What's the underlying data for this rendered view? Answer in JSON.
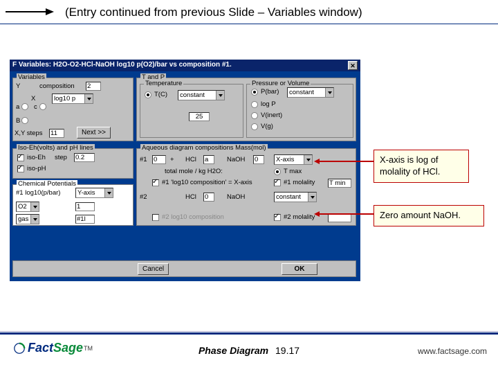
{
  "slide": {
    "title": "(Entry continued from previous Slide – Variables window)"
  },
  "window": {
    "title": "F Variables: H2O-O2-HCl-NaOH  log10 p(O2)/bar vs composition #1."
  },
  "variables": {
    "legend": "Variables",
    "y_label": "Y",
    "composition_label": "composition",
    "composition_value": "2",
    "x_label": "X",
    "log10p_label": "log10 p",
    "a_label": "a",
    "c_label": "c",
    "b_label": "B",
    "xy_steps_label": "X,Y steps",
    "xy_steps_value": "11",
    "next_label": "Next >>"
  },
  "tandp": {
    "legend": "T and P",
    "temperature_legend": "Temperature",
    "tc_label": "T(C)",
    "constant_label": "constant",
    "t_value": "25",
    "pressure_legend": "Pressure or Volume",
    "pbar_label": "P(bar)",
    "pbar_value": "constant",
    "logp_label": "log P",
    "vinert_label": "V(inert)",
    "vgas_label": "V(g)"
  },
  "iso": {
    "legend": "Iso-Eh(volts) and pH lines",
    "eh_label": "iso-Eh",
    "ph_label": "iso-pH",
    "step_label": "step",
    "step_value": "0.2"
  },
  "aqueous": {
    "legend": "Aqueous diagram compositions Mass(mol)",
    "row1_num": "#1",
    "row1_val1": "0",
    "row1_plus": "+",
    "row1_hcl": "HCl",
    "row1_a": "a",
    "row1_naoh": "NaOH",
    "row1_b": "0",
    "row1_xaxis": "X-axis",
    "total_label": "total mole / kg H2O:",
    "row2_num": "#2",
    "row2_hcl": "HCl",
    "row2_a": "0",
    "row2_naoh": "NaOH",
    "row2_constant": "constant",
    "chk1a": "#1 'log10 composition' = X-axis",
    "chk1b": "#1 molality",
    "chk2a": "#2 log10 composition",
    "chk2b": "#2 molality",
    "tmax": "T max",
    "tmin": "T min"
  },
  "chempot": {
    "legend": "Chemical Potentials",
    "h1_label": "#1 log10(p/bar)",
    "yaxis": "Y-axis",
    "o2_label": "O2",
    "o2_val": "1",
    "gas_label": "gas",
    "h1l": "#1l"
  },
  "buttons": {
    "cancel": "Cancel",
    "ok": "OK"
  },
  "callouts": {
    "c1a": "X-axis is log of",
    "c1b": "molality of HCl.",
    "c2": "Zero amount NaOH."
  },
  "footer": {
    "label": "Phase Diagram",
    "pagenum": "19.17",
    "url": "www.factsage.com",
    "logo_fact": "Fact",
    "logo_sage": "Sage"
  }
}
